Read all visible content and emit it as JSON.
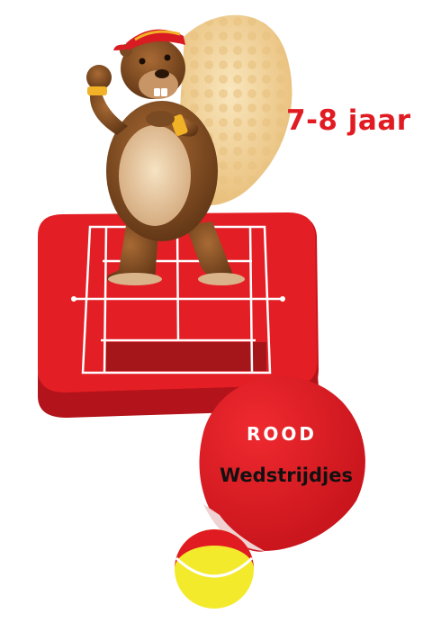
{
  "age_label": "7-8 jaar",
  "level_label": "ROOD",
  "activity_label": "Wedstrijdjes",
  "colors": {
    "brand_red": "#e11b22",
    "court_red": "#e31e24",
    "court_dark": "#a5161a",
    "tail": "#f3d9a0",
    "ball_yellow": "#f4ea2c",
    "fur": "#8a5325"
  },
  "icons": [
    "beaver-mascot",
    "tennis-court",
    "tennis-ball",
    "sticker-circle"
  ]
}
